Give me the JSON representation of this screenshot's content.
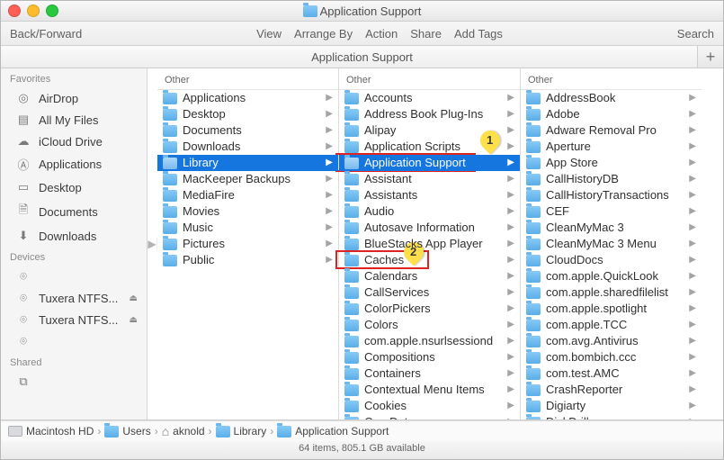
{
  "window": {
    "title": "Application Support"
  },
  "toolbar": {
    "back_forward": "Back/Forward",
    "menu": [
      "View",
      "Arrange By",
      "Action",
      "Share",
      "Add Tags"
    ],
    "search": "Search"
  },
  "pathheader": {
    "title": "Application Support",
    "add": "+"
  },
  "sidebar": {
    "sections": [
      {
        "title": "Favorites",
        "items": [
          {
            "icon": "airdrop",
            "label": "AirDrop"
          },
          {
            "icon": "allfiles",
            "label": "All My Files"
          },
          {
            "icon": "cloud",
            "label": "iCloud Drive"
          },
          {
            "icon": "apps",
            "label": "Applications"
          },
          {
            "icon": "desktop",
            "label": "Desktop"
          },
          {
            "icon": "docs",
            "label": "Documents"
          },
          {
            "icon": "downloads",
            "label": "Downloads"
          }
        ]
      },
      {
        "title": "Devices",
        "items": [
          {
            "icon": "disk",
            "label": "",
            "eject": false
          },
          {
            "icon": "disk",
            "label": "Tuxera NTFS...",
            "eject": true
          },
          {
            "icon": "disk",
            "label": "Tuxera NTFS...",
            "eject": true
          },
          {
            "icon": "disk",
            "label": "",
            "eject": false
          }
        ]
      },
      {
        "title": "Shared",
        "items": [
          {
            "icon": "shared",
            "label": ""
          }
        ]
      }
    ]
  },
  "columns": [
    {
      "header": "Other",
      "items": [
        {
          "label": "Applications",
          "selected": false
        },
        {
          "label": "Desktop",
          "selected": false
        },
        {
          "label": "Documents",
          "selected": false
        },
        {
          "label": "Downloads",
          "selected": false
        },
        {
          "label": "Library",
          "selected": true,
          "muted": true
        },
        {
          "label": "MacKeeper Backups",
          "selected": false
        },
        {
          "label": "MediaFire",
          "selected": false
        },
        {
          "label": "Movies",
          "selected": false
        },
        {
          "label": "Music",
          "selected": false
        },
        {
          "label": "Pictures",
          "selected": false
        },
        {
          "label": "Public",
          "selected": false
        }
      ]
    },
    {
      "header": "Other",
      "items": [
        {
          "label": "Accounts"
        },
        {
          "label": "Address Book Plug-Ins"
        },
        {
          "label": "Alipay"
        },
        {
          "label": "Application Scripts"
        },
        {
          "label": "Application Support",
          "selected": true
        },
        {
          "label": "Assistant"
        },
        {
          "label": "Assistants"
        },
        {
          "label": "Audio"
        },
        {
          "label": "Autosave Information"
        },
        {
          "label": "BlueStacks App Player"
        },
        {
          "label": "Caches"
        },
        {
          "label": "Calendars"
        },
        {
          "label": "CallServices"
        },
        {
          "label": "ColorPickers"
        },
        {
          "label": "Colors"
        },
        {
          "label": "com.apple.nsurlsessiond"
        },
        {
          "label": "Compositions"
        },
        {
          "label": "Containers"
        },
        {
          "label": "Contextual Menu Items"
        },
        {
          "label": "Cookies"
        },
        {
          "label": "CoreData"
        }
      ]
    },
    {
      "header": "Other",
      "items": [
        {
          "label": "AddressBook"
        },
        {
          "label": "Adobe"
        },
        {
          "label": "Adware Removal Pro"
        },
        {
          "label": "Aperture"
        },
        {
          "label": "App Store"
        },
        {
          "label": "CallHistoryDB"
        },
        {
          "label": "CallHistoryTransactions"
        },
        {
          "label": "CEF"
        },
        {
          "label": "CleanMyMac 3"
        },
        {
          "label": "CleanMyMac 3 Menu"
        },
        {
          "label": "CloudDocs"
        },
        {
          "label": "com.apple.QuickLook"
        },
        {
          "label": "com.apple.sharedfilelist"
        },
        {
          "label": "com.apple.spotlight"
        },
        {
          "label": "com.apple.TCC"
        },
        {
          "label": "com.avg.Antivirus"
        },
        {
          "label": "com.bombich.ccc"
        },
        {
          "label": "com.test.AMC"
        },
        {
          "label": "CrashReporter"
        },
        {
          "label": "Digiarty"
        },
        {
          "label": "DiskDrill"
        }
      ]
    }
  ],
  "annotations": {
    "pin1": "1",
    "pin2": "2"
  },
  "pathbar": {
    "segments": [
      {
        "icon": "hd",
        "label": "Macintosh HD"
      },
      {
        "icon": "folder",
        "label": "Users"
      },
      {
        "icon": "home",
        "label": "aknold"
      },
      {
        "icon": "folder",
        "label": "Library"
      },
      {
        "icon": "folder",
        "label": "Application Support"
      }
    ]
  },
  "status": "64 items, 805.1 GB available"
}
